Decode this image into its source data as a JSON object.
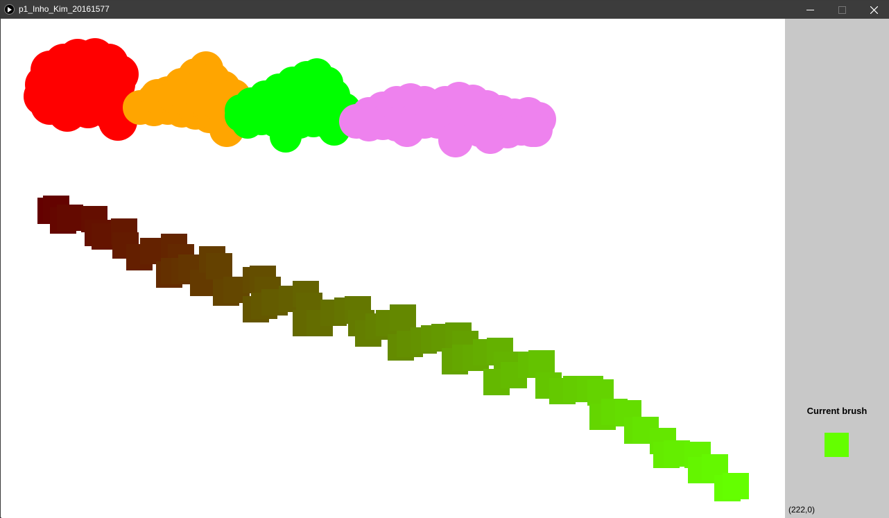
{
  "window": {
    "title": "p1_Inho_Kim_20161577",
    "icon": "processing-play-icon",
    "controls": [
      "minimize-icon",
      "maximize-icon",
      "close-icon"
    ]
  },
  "canvas": {
    "background": "#ffffff",
    "circle_strokes": [
      {
        "color": "#ff0000"
      },
      {
        "color": "#ffa500"
      },
      {
        "color": "#00ff00"
      },
      {
        "color": "#ee82ee"
      }
    ],
    "gradient_stroke": {
      "start_color": "#640000",
      "end_color": "#64ff00"
    }
  },
  "panel": {
    "background": "#c8c8c8",
    "brush_label": "Current brush",
    "brush_color": "#64ff00",
    "brush_shape": "square",
    "coordinates": "(222,0)"
  }
}
